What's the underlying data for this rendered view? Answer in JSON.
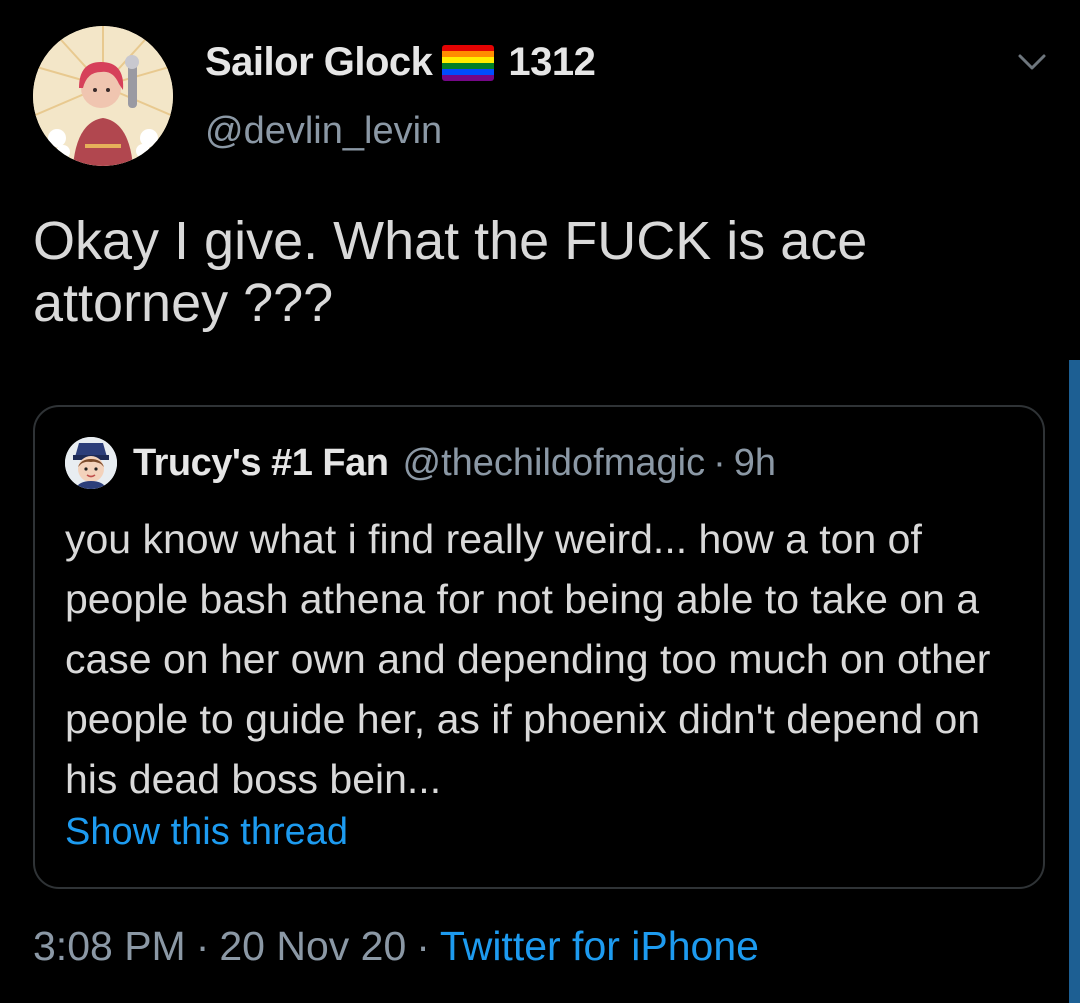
{
  "author": {
    "display_name": "Sailor Glock",
    "name_suffix": "1312",
    "handle": "@devlin_levin",
    "flag_icon": "rainbow-flag-icon"
  },
  "tweet": {
    "text": "Okay I give. What the FUCK is ace attorney ???"
  },
  "quoted_tweet": {
    "display_name": "Trucy's #1 Fan",
    "handle": "@thechildofmagic",
    "separator": "·",
    "time": "9h",
    "text": "you know what i find really weird... how a ton of people bash athena for not being able to take on a case on her own and depending too much on other people to guide her, as if phoenix didn't depend on his dead boss bein...",
    "show_thread_label": "Show this thread"
  },
  "meta": {
    "time": "3:08 PM",
    "separator": "·",
    "date": "20 Nov 20",
    "source": "Twitter for iPhone"
  },
  "colors": {
    "background": "#000000",
    "text_primary": "#d9d9d9",
    "text_secondary": "#8b98a5",
    "link": "#1d9bf0",
    "card_border": "#2f3336"
  }
}
